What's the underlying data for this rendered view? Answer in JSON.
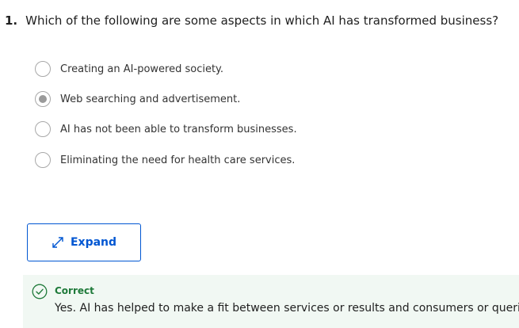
{
  "question": {
    "number": "1.",
    "text": "Which of the following are some aspects in which AI has transformed business?"
  },
  "options": [
    {
      "label": "Creating an AI-powered society.",
      "selected": false
    },
    {
      "label": "Web searching and advertisement.",
      "selected": true
    },
    {
      "label": "AI has not been able to transform businesses.",
      "selected": false
    },
    {
      "label": "Eliminating the need for health care services.",
      "selected": false
    }
  ],
  "expand_button": {
    "label": "Expand",
    "icon": "expand-arrows-icon"
  },
  "feedback": {
    "status": "Correct",
    "text": "Yes. AI has helped to make a fit between services or results and consumers or queries.",
    "icon": "check-circle-icon"
  },
  "colors": {
    "accent": "#0056d2",
    "success": "#1f7a3a",
    "feedback_bg": "#f1f8f3"
  }
}
